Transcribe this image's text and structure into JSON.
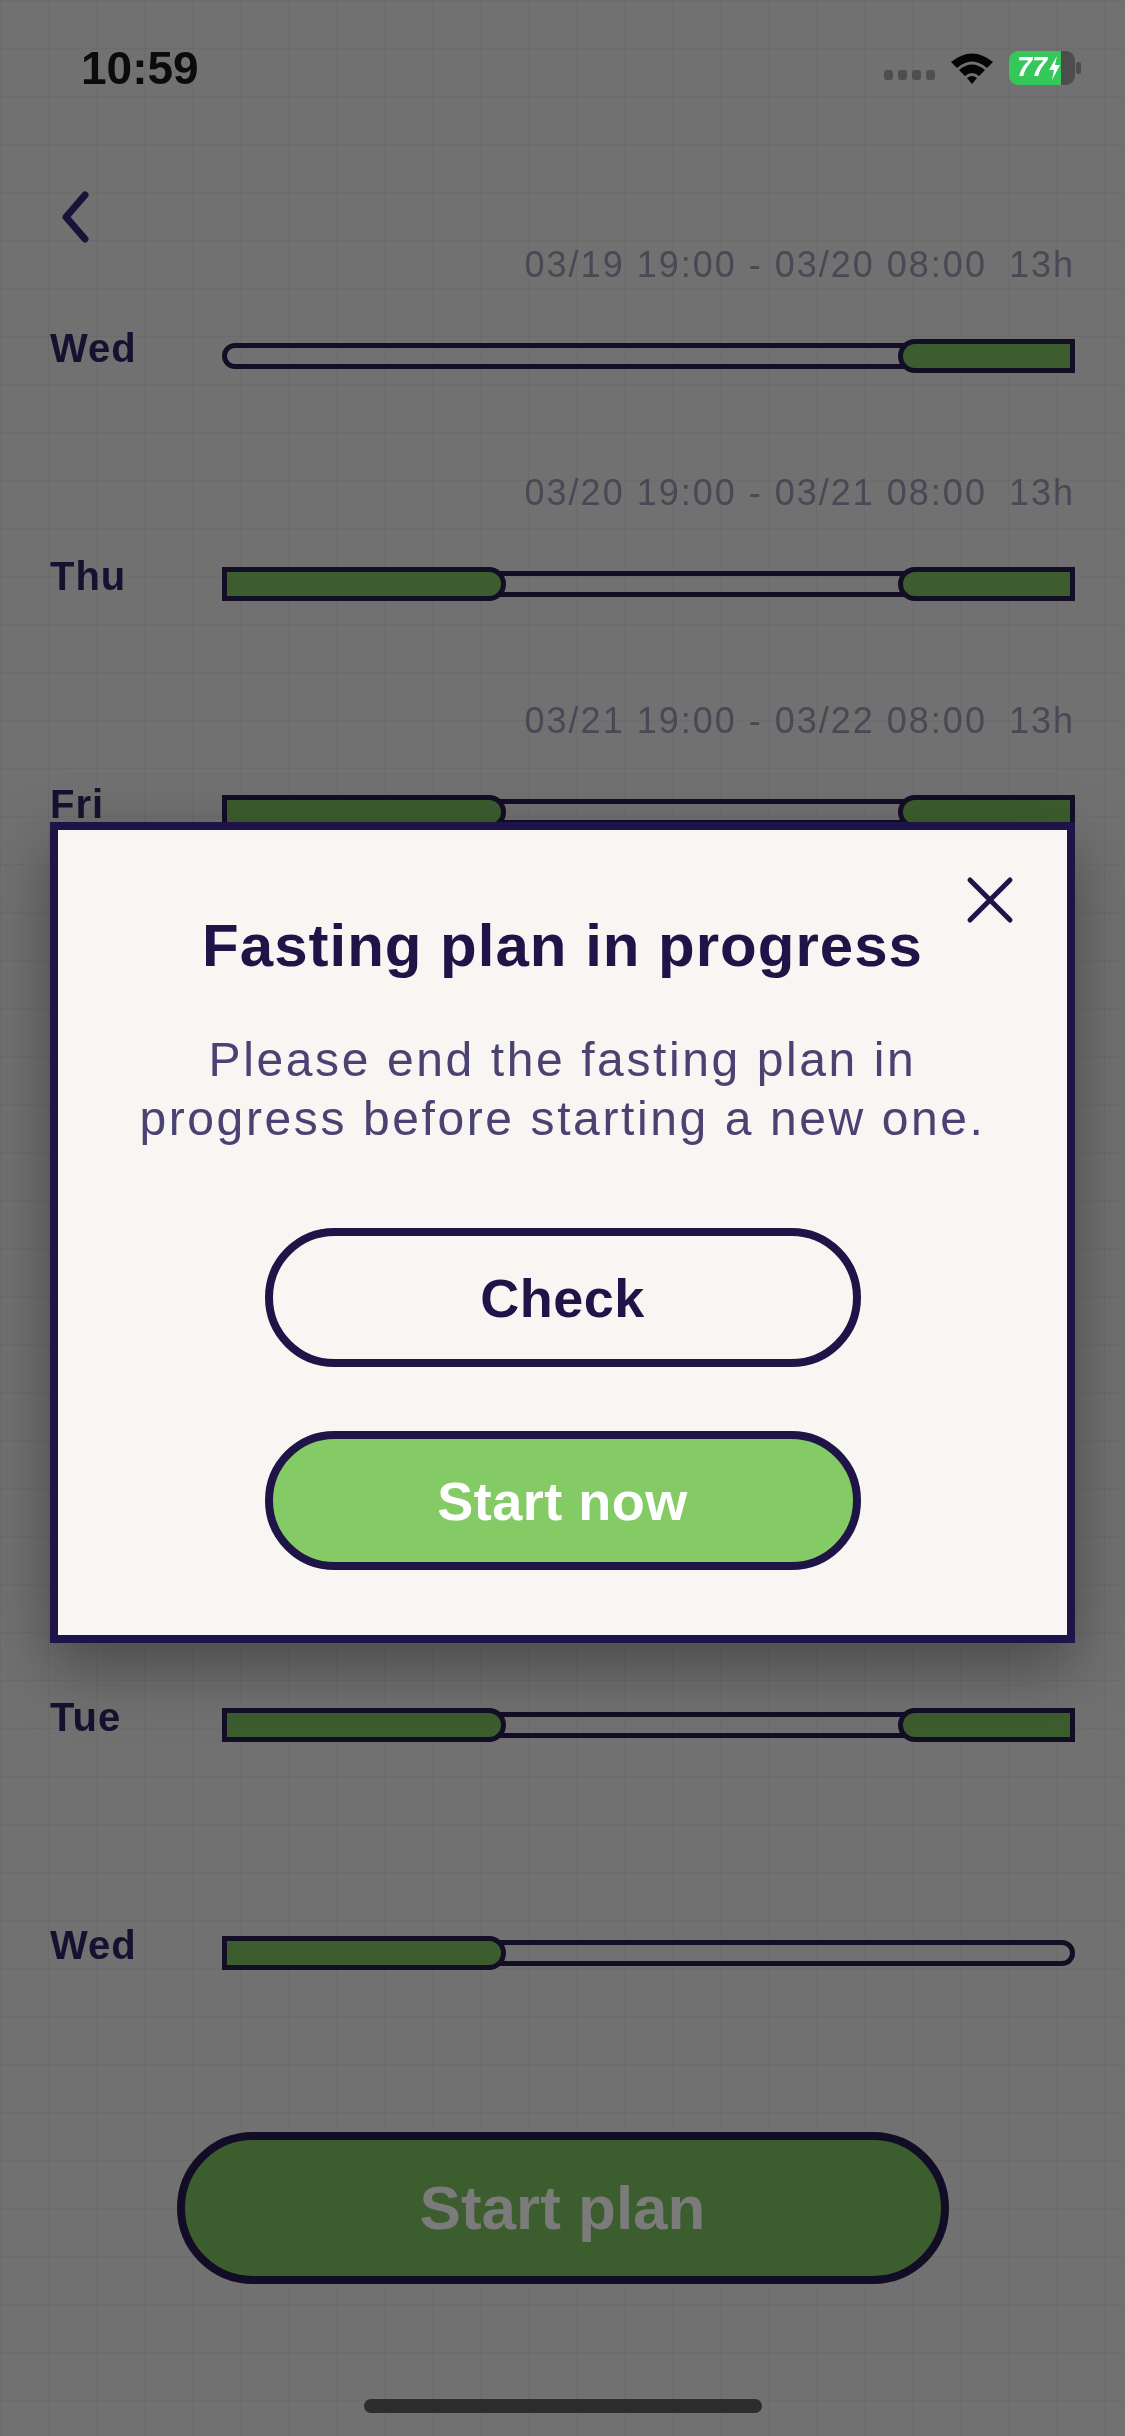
{
  "status_bar": {
    "time": "10:59",
    "battery": "77"
  },
  "days_above_dialog": [
    {
      "day": "Wed",
      "range": "03/19 19:00 - 03/20 08:00",
      "duration": "13h",
      "segments": [
        {
          "kind": "end",
          "level": 0.208
        }
      ]
    },
    {
      "day": "Thu",
      "range": "03/20 19:00 - 03/21 08:00",
      "duration": "13h",
      "segments": [
        {
          "kind": "start",
          "level": 0.333
        },
        {
          "kind": "end",
          "level": 0.208
        }
      ]
    },
    {
      "day": "Fri",
      "range": "03/21 19:00 - 03/22 08:00",
      "duration": "13h",
      "segments": [
        {
          "kind": "start",
          "level": 0.333
        },
        {
          "kind": "end",
          "level": 0.208
        }
      ]
    }
  ],
  "days_below_dialog": [
    {
      "day": "Tue",
      "segments": [
        {
          "kind": "start",
          "level": 0.333
        },
        {
          "kind": "end",
          "level": 0.208
        }
      ]
    },
    {
      "day": "Wed",
      "segments": [
        {
          "kind": "start",
          "level": 0.333
        }
      ]
    }
  ],
  "dialog": {
    "title": "Fasting plan in progress",
    "message": "Please end the fasting plan in progress before starting a new one.",
    "buttons": [
      {
        "label": "Check",
        "kind": "outline"
      },
      {
        "label": "Start now",
        "kind": "primary"
      }
    ]
  },
  "footer_button": {
    "label": "Start plan"
  }
}
